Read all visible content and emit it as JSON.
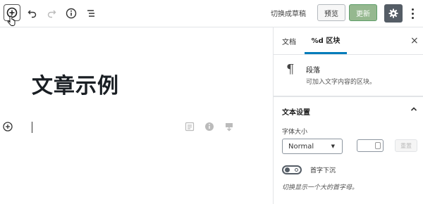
{
  "toolbar": {
    "add_block_icon": "plus-circle-icon",
    "undo_icon": "undo-icon",
    "redo_icon": "redo-icon",
    "info_icon": "info-icon",
    "outline_icon": "list-icon",
    "switch_to_draft": "切换成草稿",
    "preview": "预览",
    "update": "更新",
    "settings_icon": "gear-icon",
    "more_icon": "more-vertical-icon"
  },
  "editor": {
    "title": "文章示例"
  },
  "sidebar": {
    "tabs": [
      {
        "label": "文档",
        "active": false
      },
      {
        "label": "%d 区块",
        "active": true
      }
    ],
    "close": "×",
    "block": {
      "icon": "¶",
      "name": "段落",
      "description": "可加入文字内容的区块。"
    },
    "text_settings": {
      "title": "文本设置",
      "font_size_label": "字体大小",
      "font_size_value": "Normal",
      "reset_label": "重置",
      "drop_cap_label": "首字下沉",
      "drop_cap_help": "切换显示一个大的首字母。",
      "drop_cap_enabled": false
    }
  },
  "colors": {
    "accent": "#007cba",
    "update_bg": "#95b88f",
    "settings_bg": "#555d66"
  }
}
